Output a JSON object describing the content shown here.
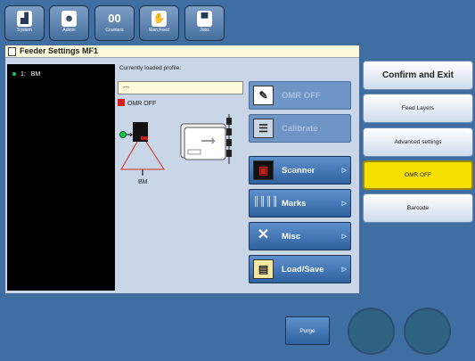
{
  "topbar": {
    "buttons": [
      {
        "label": "System",
        "icon": "system-icon"
      },
      {
        "label": "Admin",
        "icon": "admin-icon"
      },
      {
        "label": "Counters",
        "icon": "counters-icon"
      },
      {
        "label": "Man.Feed",
        "icon": "hand-icon"
      },
      {
        "label": "Jobs",
        "icon": "jobs-icon"
      }
    ]
  },
  "panel": {
    "title": "Feeder Settings MF1",
    "feeders": [
      {
        "index": "1:",
        "name": "BM"
      }
    ],
    "profile_label": "Currently loaded profile:",
    "profile_value": "---",
    "omr_status": "OMR OFF",
    "diagram_label": "BM"
  },
  "actions": {
    "omr_off": "OMR OFF",
    "calibrate": "Calibrate",
    "scanner": "Scanner",
    "marks": "Marks",
    "misc": "Misc",
    "load_save": "Load/Save"
  },
  "right": {
    "confirm": "Confirm and Exit",
    "feed_layers": "Feed Layers",
    "advanced": "Advanced settings",
    "omr_off": "OMR OFF",
    "barcode": "Barcode"
  },
  "bottom": {
    "purge": "Purge"
  },
  "colors": {
    "background": "#3f6ea3",
    "panel": "#c8d6e8",
    "highlight": "#f5df00",
    "status_red": "#d81b1b"
  }
}
